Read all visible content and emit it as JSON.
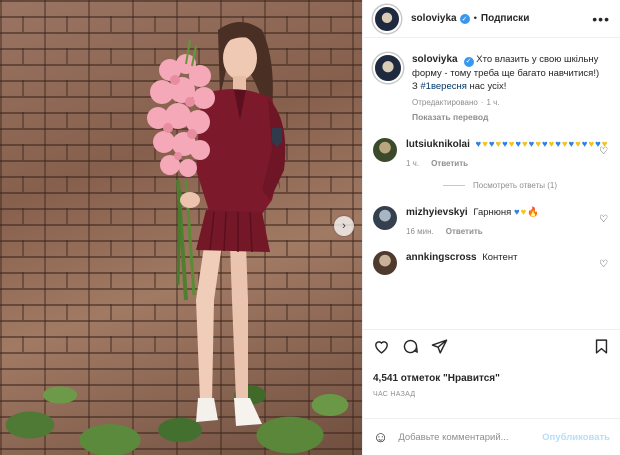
{
  "colors": {
    "accent": "#0095f6",
    "link": "#00376b",
    "muted": "#8e8e8e",
    "verified": "#3897f0"
  },
  "header": {
    "username": "soloviyka",
    "separator": "•",
    "follow_label": "Подписки",
    "more_icon": "more-horizontal-icon"
  },
  "caption": {
    "username": "soloviyka",
    "text_before": "Хто влазить у свою шкільну форму - тому треба ще багато навчитися!)",
    "text_line2_prefix": "З ",
    "hashtag": "#1вересня",
    "text_line2_suffix": " нас усіх!",
    "edited": "Отредактировано",
    "time": "1 ч.",
    "translate": "Показать перевод"
  },
  "comments": [
    {
      "username": "lutsiuknikolai",
      "hearts": [
        "blue",
        "yellow",
        "blue",
        "yellow",
        "blue",
        "yellow",
        "blue",
        "yellow",
        "blue",
        "yellow",
        "blue",
        "yellow",
        "blue",
        "yellow",
        "blue",
        "yellow",
        "blue",
        "yellow",
        "blue",
        "yellow"
      ],
      "time": "1 ч.",
      "reply": "Ответить",
      "view_replies": "Посмотреть ответы (1)"
    },
    {
      "username": "mizhyievskyi",
      "text": "Гарнюня",
      "extra": "🔥",
      "time": "16 мин.",
      "reply": "Ответить"
    },
    {
      "username": "annkingscross",
      "text": "Контент"
    }
  ],
  "actions": {
    "like_icon": "heart-icon",
    "comment_icon": "comment-icon",
    "share_icon": "share-icon",
    "save_icon": "bookmark-icon"
  },
  "likes": "4,541 отметок \"Нравится\"",
  "timestamp": "ЧАС НАЗАД",
  "add_comment": {
    "placeholder": "Добавьте комментарий...",
    "publish_label": "Опубликовать"
  }
}
